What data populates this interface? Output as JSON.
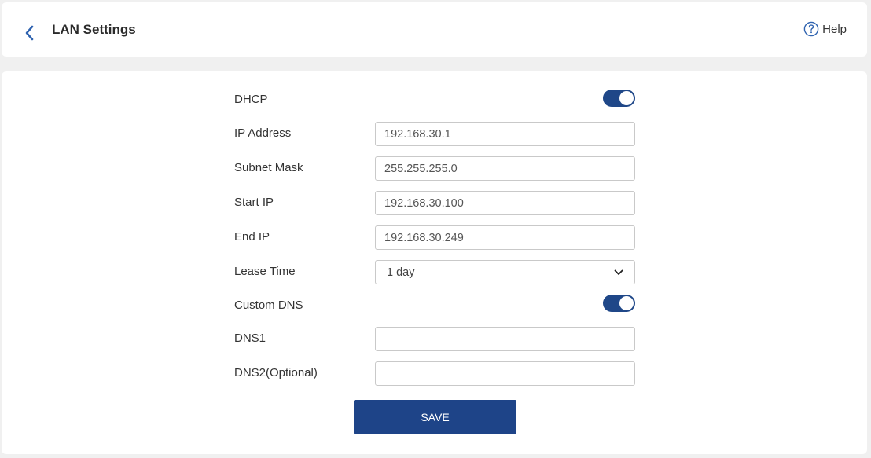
{
  "header": {
    "title": "LAN Settings",
    "help_label": "Help"
  },
  "form": {
    "dhcp": {
      "label": "DHCP",
      "enabled": true
    },
    "ip_address": {
      "label": "IP Address",
      "value": "192.168.30.1"
    },
    "subnet_mask": {
      "label": "Subnet Mask",
      "value": "255.255.255.0"
    },
    "start_ip": {
      "label": "Start IP",
      "value": "192.168.30.100"
    },
    "end_ip": {
      "label": "End IP",
      "value": "192.168.30.249"
    },
    "lease_time": {
      "label": "Lease Time",
      "value": "1 day"
    },
    "custom_dns": {
      "label": "Custom DNS",
      "enabled": true
    },
    "dns1": {
      "label": "DNS1",
      "value": ""
    },
    "dns2": {
      "label": "DNS2(Optional)",
      "value": ""
    },
    "save_label": "SAVE"
  },
  "icons": {
    "back": "chevron-left-icon",
    "help": "question-circle-icon",
    "dropdown": "chevron-down-icon"
  },
  "colors": {
    "accent": "#1f4788",
    "back_arrow": "#2f63b0",
    "background": "#f0f0f0"
  }
}
